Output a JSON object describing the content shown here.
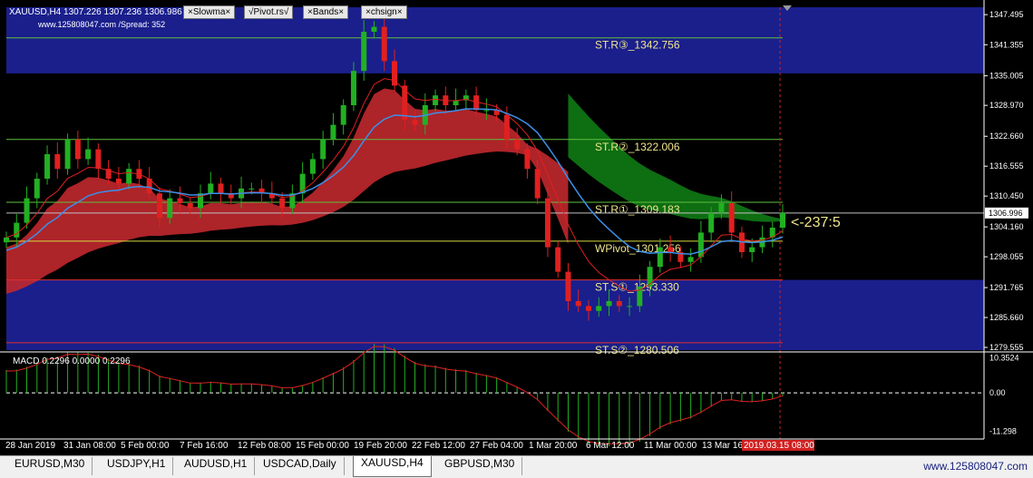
{
  "header": {
    "symbol_info": "XAUUSD,H4  1307.226 1307.236 1306.986 13",
    "watermark_line": "www.125808047.com /Spread:   352"
  },
  "indicator_buttons": [
    {
      "label": "×Slowma×"
    },
    {
      "label": "√Pivot.rs√"
    },
    {
      "label": "×Bands×"
    },
    {
      "label": "×chsign×"
    }
  ],
  "levels": [
    {
      "label": "ST.R③_1342.756",
      "value": 1342.756,
      "color": "#5fbf3f"
    },
    {
      "label": "ST.R②_1322.006",
      "value": 1322.006,
      "color": "#5fbf3f"
    },
    {
      "label": "ST.R①_1309.183",
      "value": 1309.183,
      "color": "#5fbf3f"
    },
    {
      "label": "WPivot_1301.256",
      "value": 1301.256,
      "color": "#d8d840"
    },
    {
      "label": "ST.S①_1293.330",
      "value": 1293.33,
      "color": "#e03030"
    },
    {
      "label": "ST.S②_1280.506",
      "value": 1280.506,
      "color": "#e03030"
    }
  ],
  "price_tag": "<-237:5",
  "current_price": "1306.996",
  "chart_data": {
    "type": "line",
    "symbol": "XAUUSD",
    "timeframe": "H4",
    "y_ticks": [
      "1347.495",
      "1341.355",
      "1335.005",
      "1328.970",
      "1322.660",
      "1316.555",
      "1310.450",
      "1304.160",
      "1298.055",
      "1291.765",
      "1285.660",
      "1279.555"
    ],
    "y_tick_values": [
      1347.495,
      1341.355,
      1335.005,
      1328.97,
      1322.66,
      1316.555,
      1310.45,
      1304.16,
      1298.055,
      1291.765,
      1285.66,
      1279.555
    ],
    "ylim": [
      1279.0,
      1349.0
    ],
    "x_ticks": [
      "28 Jan 2019",
      "31 Jan 08:00",
      "5 Feb 00:00",
      "7 Feb 16:00",
      "12 Feb 08:00",
      "15 Feb 00:00",
      "19 Feb 20:00",
      "22 Feb 12:00",
      "27 Feb 04:00",
      "1 Mar 20:00",
      "6 Mar 12:00",
      "11 Mar 00:00",
      "13 Mar 16:"
    ],
    "cursor_time": "2019.03.15 08:00",
    "close_series": [
      1302,
      1305,
      1310,
      1314,
      1319,
      1316,
      1322,
      1318,
      1320,
      1316,
      1314,
      1313,
      1316,
      1314,
      1311,
      1306,
      1310,
      1309,
      1308,
      1311,
      1313,
      1311,
      1310,
      1312,
      1312,
      1311,
      1310,
      1308,
      1311,
      1315,
      1318,
      1322,
      1325,
      1329,
      1336,
      1344,
      1345,
      1338,
      1333,
      1326,
      1325,
      1329,
      1331,
      1329,
      1330,
      1331,
      1328,
      1328,
      1327,
      1322,
      1320,
      1316,
      1310,
      1300,
      1295,
      1289,
      1288,
      1287,
      1288,
      1289,
      1288,
      1288,
      1292,
      1296,
      1300,
      1299,
      1297,
      1298,
      1303,
      1307,
      1309,
      1303,
      1299,
      1300,
      1302,
      1304,
      1307
    ],
    "macd": {
      "label": "MACD 0.2296 0.0000 0.2296",
      "y_ticks": [
        "10.3524",
        "0.00",
        "-11.298"
      ],
      "ylim": [
        -12,
        11
      ]
    }
  },
  "tabs": [
    {
      "label": "EURUSD,M30",
      "active": false
    },
    {
      "label": "USDJPY,H1",
      "active": false
    },
    {
      "label": "AUDUSD,H1",
      "active": false
    },
    {
      "label": "USDCAD,Daily",
      "active": false
    },
    {
      "label": "XAUUSD,H4",
      "active": true
    },
    {
      "label": "GBPUSD,M30",
      "active": false
    }
  ],
  "footer_watermark": "www.125808047.com",
  "colors": {
    "band_blue": "#1a1f8c",
    "ribbon_red": "#c0282d",
    "ribbon_green": "#0f7a14",
    "ma_blue": "#3c8fe8",
    "ma_red": "#e02020",
    "candle_green": "#22b022",
    "candle_red": "#e02020"
  }
}
